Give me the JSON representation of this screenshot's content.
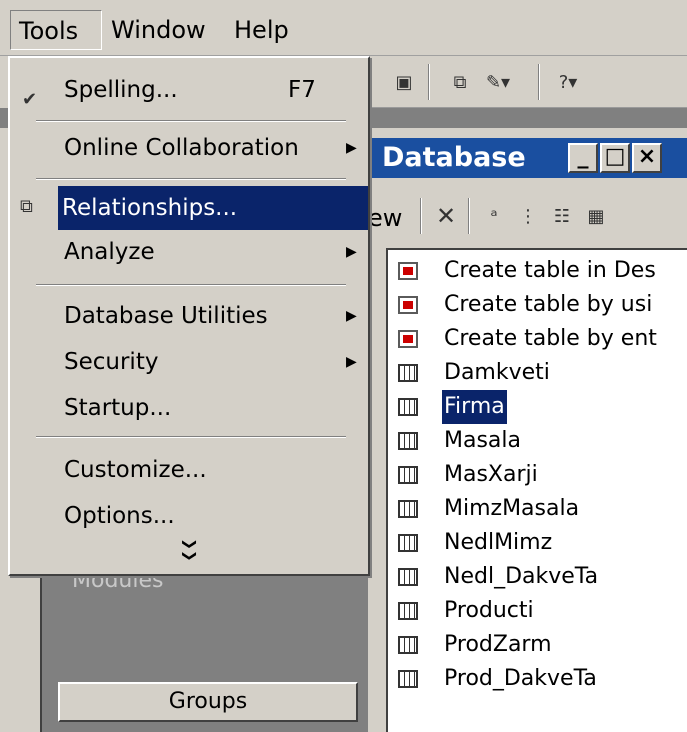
{
  "menubar": {
    "items": [
      {
        "label": "Tools"
      },
      {
        "label": "Window"
      },
      {
        "label": "Help"
      }
    ]
  },
  "tools_menu": {
    "items": [
      {
        "label": "Spelling...",
        "shortcut": "F7",
        "icon": "spelling-icon"
      },
      {
        "label": "Online Collaboration",
        "submenu": true
      },
      {
        "label": "Relationships...",
        "icon": "relationships-icon",
        "selected": true
      },
      {
        "label": "Analyze",
        "submenu": true
      },
      {
        "label": "Database Utilities",
        "submenu": true
      },
      {
        "label": "Security",
        "submenu": true
      },
      {
        "label": "Startup..."
      },
      {
        "label": "Customize..."
      },
      {
        "label": "Options..."
      }
    ],
    "more_icon": "chevron-double-down-icon"
  },
  "database_window": {
    "title": "Database",
    "toolbar_label": "ew",
    "objects": [
      {
        "label": "Create table in Des",
        "type": "wizard"
      },
      {
        "label": "Create table by usi",
        "type": "wizard"
      },
      {
        "label": "Create table by ent",
        "type": "wizard"
      },
      {
        "label": "Damkveti",
        "type": "table"
      },
      {
        "label": "Firma",
        "type": "table",
        "selected": true
      },
      {
        "label": "Masala",
        "type": "table"
      },
      {
        "label": "MasXarji",
        "type": "table"
      },
      {
        "label": "MimzMasala",
        "type": "table"
      },
      {
        "label": "NedlMimz",
        "type": "table"
      },
      {
        "label": "Nedl_DakveTa",
        "type": "table"
      },
      {
        "label": "Producti",
        "type": "table"
      },
      {
        "label": "ProdZarm",
        "type": "table"
      },
      {
        "label": "Prod_DakveTa",
        "type": "table"
      }
    ]
  },
  "left_panel": {
    "modules_label": "Modules",
    "groups_label": "Groups"
  },
  "colors": {
    "menu_bg": "#d4d0c8",
    "highlight": "#0a246a",
    "title_bar": "#1a4fa0"
  }
}
